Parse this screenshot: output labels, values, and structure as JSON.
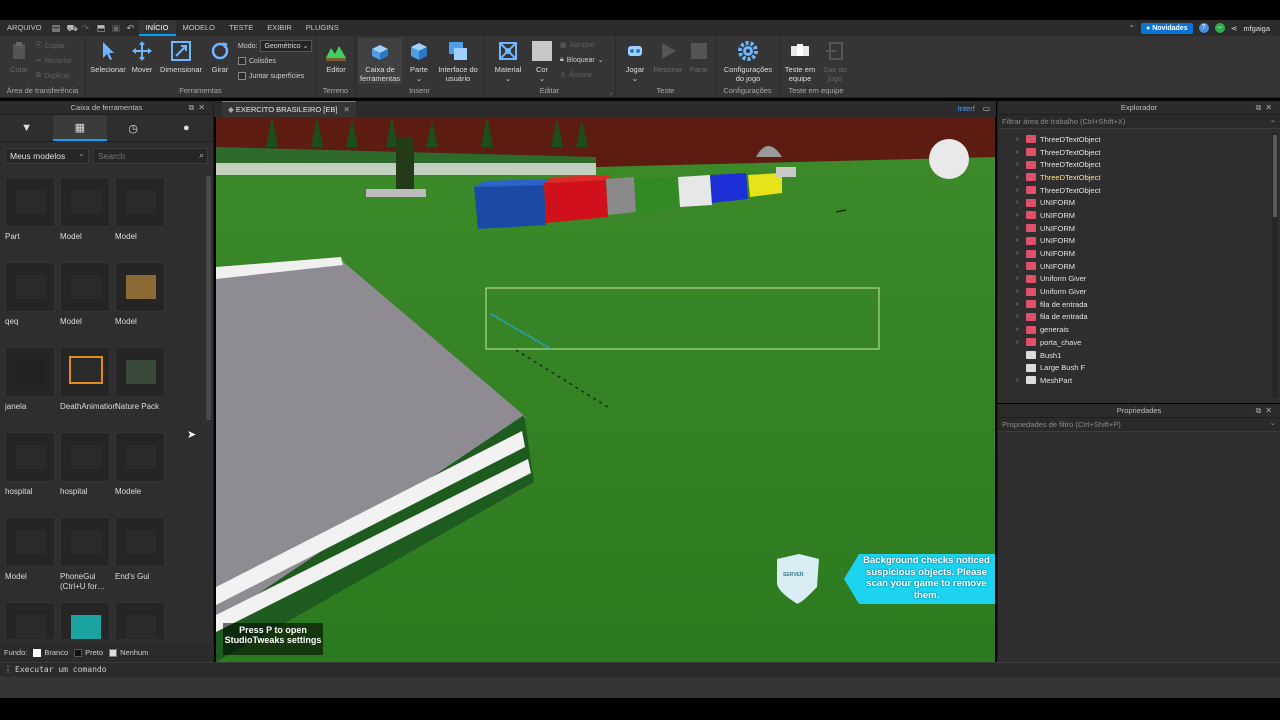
{
  "menu": {
    "tabs": [
      "ARQUIVO",
      "INÍCIO",
      "MODELO",
      "TESTE",
      "EXIBIR",
      "PLUGINS"
    ],
    "active_tab": "INÍCIO",
    "news_label": "Novidades",
    "username": "mfgaiga"
  },
  "ribbon": {
    "clipboard": {
      "paste": "Colar",
      "copy": "Copiar",
      "cut": "Recortar",
      "duplicate": "Duplicar",
      "group_label": "Área de transferência"
    },
    "tools": {
      "select": "Selecionar",
      "move": "Mover",
      "scale": "Dimensionar",
      "rotate": "Girar",
      "mode_label": "Modo:",
      "mode_value": "Geométrico",
      "collisions": "Colisões",
      "join_surfaces": "Juntar superfícies",
      "group_label": "Ferramentas"
    },
    "terrain": {
      "editor": "Editor",
      "group_label": "Terreno"
    },
    "insert": {
      "toolbox": "Caixa de ferramentas",
      "part": "Parte",
      "ui": "Interface do usuário",
      "group_label": "Inserir"
    },
    "edit": {
      "material": "Material",
      "color": "Cor",
      "group": "Agrupar",
      "lock": "Bloquear",
      "anchor": "Âncora",
      "group_label": "Editar"
    },
    "test": {
      "play": "Jogar",
      "resume": "Retomar",
      "stop": "Parar",
      "group_label": "Teste"
    },
    "settings": {
      "game_settings": "Configurações do jogo",
      "group_label": "Configurações"
    },
    "team_test": {
      "team_test": "Teste em equipe",
      "exit_game": "Sair do jogo",
      "group_label": "Teste em equipe"
    }
  },
  "toolbox": {
    "title": "Caixa de ferramentas",
    "category": "Meus modelos",
    "search_placeholder": "Search",
    "items": [
      {
        "label": "Part"
      },
      {
        "label": "Model"
      },
      {
        "label": "Model"
      },
      {
        "label": "qeq"
      },
      {
        "label": "Model"
      },
      {
        "label": "Model"
      },
      {
        "label": "janela"
      },
      {
        "label": "DeathAnimation"
      },
      {
        "label": "Nature Pack"
      },
      {
        "label": "hospital"
      },
      {
        "label": "hospital"
      },
      {
        "label": "Modele"
      },
      {
        "label": "Model"
      },
      {
        "label": "PhoneGui (Ctrl+U for…"
      },
      {
        "label": "End's Gui"
      },
      {
        "label": ""
      },
      {
        "label": ""
      },
      {
        "label": ""
      }
    ],
    "background": {
      "label": "Fundo:",
      "white": "Branco",
      "black": "Preto",
      "none": "Nenhum"
    }
  },
  "viewport": {
    "tab_title": "EXERCITO BRASILEIRO [EB]",
    "interface_label": "Interf",
    "studiotweaks": "Press P to open StudioTweaks settings",
    "warning": "Background checks noticed suspicious objects. Please scan your game to remove them.",
    "shield": "SERVER"
  },
  "explorer": {
    "title": "Explorador",
    "filter_placeholder": "Filtrar área de trabalho (Ctrl+Shift+X)",
    "items": [
      {
        "label": "ThreeDTextObject",
        "expandable": true,
        "kind": "model"
      },
      {
        "label": "ThreeDTextObject",
        "expandable": true,
        "kind": "model"
      },
      {
        "label": "ThreeDTextObject",
        "expandable": true,
        "kind": "model"
      },
      {
        "label": "ThreeDTextObject",
        "expandable": true,
        "kind": "model"
      },
      {
        "label": "ThreeDTextObject",
        "expandable": true,
        "kind": "model"
      },
      {
        "label": "UNIFORM",
        "expandable": true,
        "kind": "model"
      },
      {
        "label": "UNIFORM",
        "expandable": true,
        "kind": "model"
      },
      {
        "label": "UNIFORM",
        "expandable": true,
        "kind": "model"
      },
      {
        "label": "UNIFORM",
        "expandable": true,
        "kind": "model"
      },
      {
        "label": "UNIFORM",
        "expandable": true,
        "kind": "model"
      },
      {
        "label": "UNIFORM",
        "expandable": true,
        "kind": "model"
      },
      {
        "label": "Uniform Giver",
        "expandable": true,
        "kind": "model"
      },
      {
        "label": "Uniform Giver",
        "expandable": true,
        "kind": "model"
      },
      {
        "label": "fila de entrada",
        "expandable": true,
        "kind": "model"
      },
      {
        "label": "fila de entrada",
        "expandable": true,
        "kind": "model"
      },
      {
        "label": "generais",
        "expandable": true,
        "kind": "model"
      },
      {
        "label": "porta_chave",
        "expandable": true,
        "kind": "model"
      },
      {
        "label": "Bush1",
        "expandable": false,
        "kind": "mesh"
      },
      {
        "label": "Large Bush F",
        "expandable": false,
        "kind": "mesh"
      },
      {
        "label": "MeshPart",
        "expandable": true,
        "kind": "mesh"
      }
    ]
  },
  "properties": {
    "title": "Propriedades",
    "filter_placeholder": "Propriedades de filtro (Ctrl+Shift+P)"
  },
  "command_bar": {
    "placeholder": "Executar um comando"
  }
}
